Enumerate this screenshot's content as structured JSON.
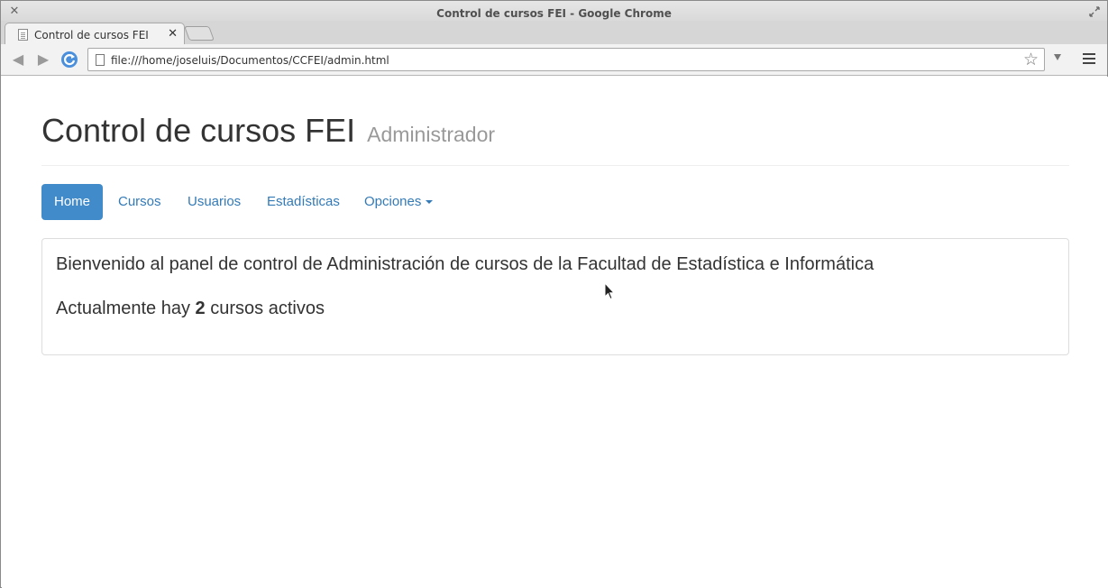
{
  "window": {
    "title": "Control de cursos FEI - Google Chrome"
  },
  "tabs": [
    {
      "label": "Control de cursos FEI"
    }
  ],
  "address_bar": {
    "url": "file:///home/joseluis/Documentos/CCFEI/admin.html"
  },
  "header": {
    "title": "Control de cursos FEI",
    "subtitle": "Administrador"
  },
  "nav": {
    "items": [
      {
        "label": "Home",
        "active": true
      },
      {
        "label": "Cursos"
      },
      {
        "label": "Usuarios"
      },
      {
        "label": "Estadísticas"
      },
      {
        "label": "Opciones",
        "dropdown": true
      }
    ]
  },
  "panel": {
    "welcome": "Bienvenido al panel de control de Administración de cursos de la Facultad de Estadística e Informática",
    "active_prefix": "Actualmente hay",
    "active_count": "2",
    "active_suffix": "cursos activos"
  },
  "colors": {
    "accent": "#428bca",
    "link": "#337ab7"
  },
  "icons": [
    "close-icon",
    "maximize-icon",
    "document-icon",
    "back-icon",
    "forward-icon",
    "reload-icon",
    "star-icon",
    "menu-icon",
    "caret-down-icon",
    "mouse-pointer-icon"
  ]
}
